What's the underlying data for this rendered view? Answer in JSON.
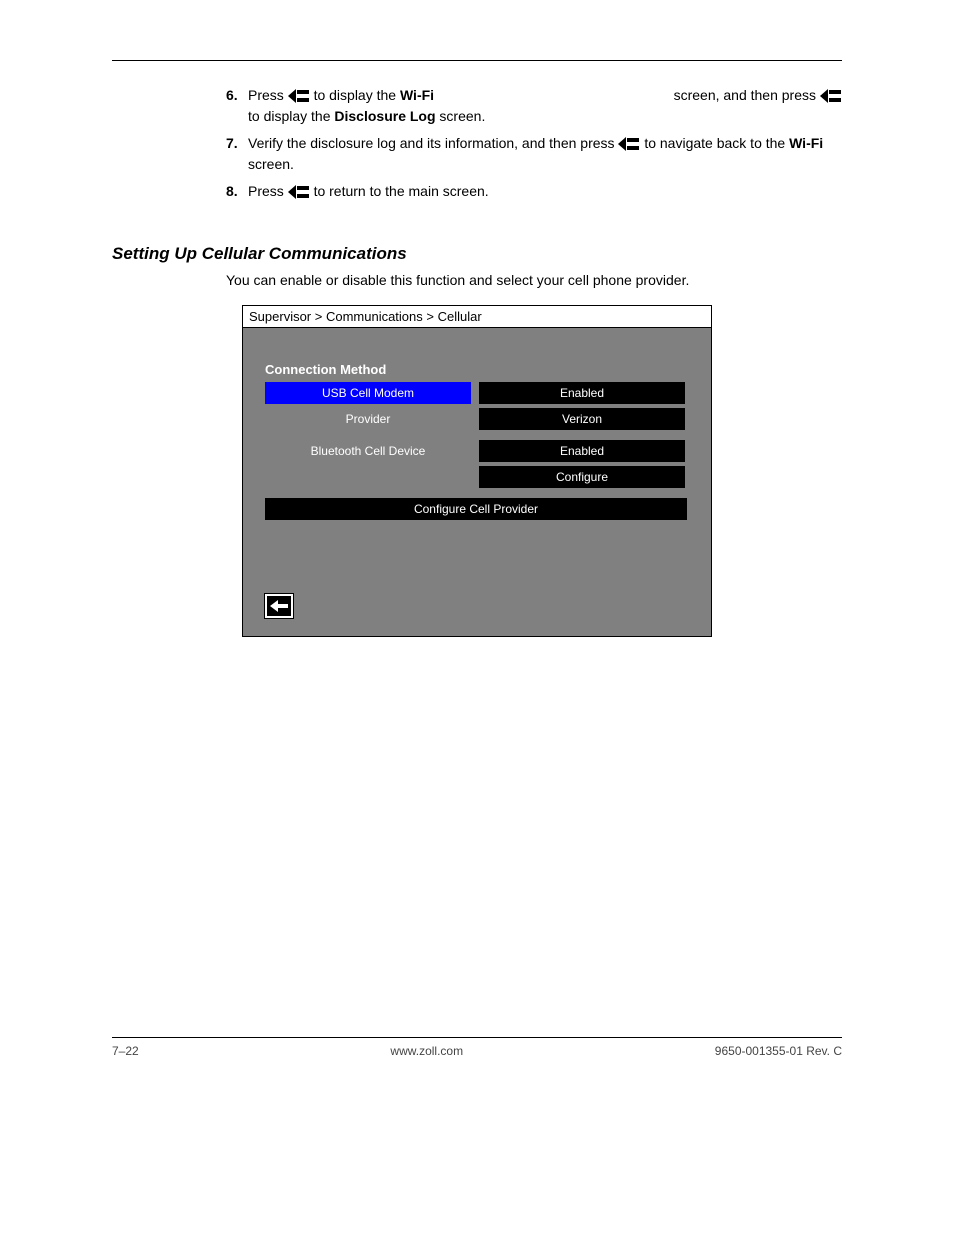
{
  "steps": {
    "step6": {
      "num": "6.",
      "pre": "Press ",
      "post_inline": " to display the ",
      "bold1": "Wi-Fi  ",
      "mid": " screen, and then press ",
      "post": " to display the ",
      "bold2": "Disclosure Log",
      "tail": " screen."
    },
    "step7": {
      "num": "7.",
      "pre": "Verify the disclosure log and its information, and then press ",
      "mid": " to navigate back to the ",
      "bold": "Wi-Fi",
      "tail": " screen."
    },
    "step8": {
      "num": "8.",
      "pre": "Press ",
      "post": " to return to the main screen."
    }
  },
  "section": {
    "heading": "Setting Up Cellular Communications",
    "para": "You can enable or disable this function and select your cell phone provider."
  },
  "screenshot": {
    "breadcrumb": "Supervisor > Communications > Cellular",
    "section_label": "Connection Method",
    "rows": [
      {
        "label": "USB Cell Modem",
        "value": "Enabled",
        "highlight": true
      },
      {
        "label": "Provider",
        "value": "Verizon",
        "highlight": false
      },
      {
        "label": "Bluetooth Cell Device",
        "value": "Enabled",
        "highlight": false
      },
      {
        "label": "",
        "value": "Configure",
        "highlight": false
      }
    ],
    "full_button": "Configure Cell Provider"
  },
  "footer": {
    "page": "7–22",
    "docref": "www.zoll.com",
    "docid": "9650-001355-01 Rev. C"
  }
}
